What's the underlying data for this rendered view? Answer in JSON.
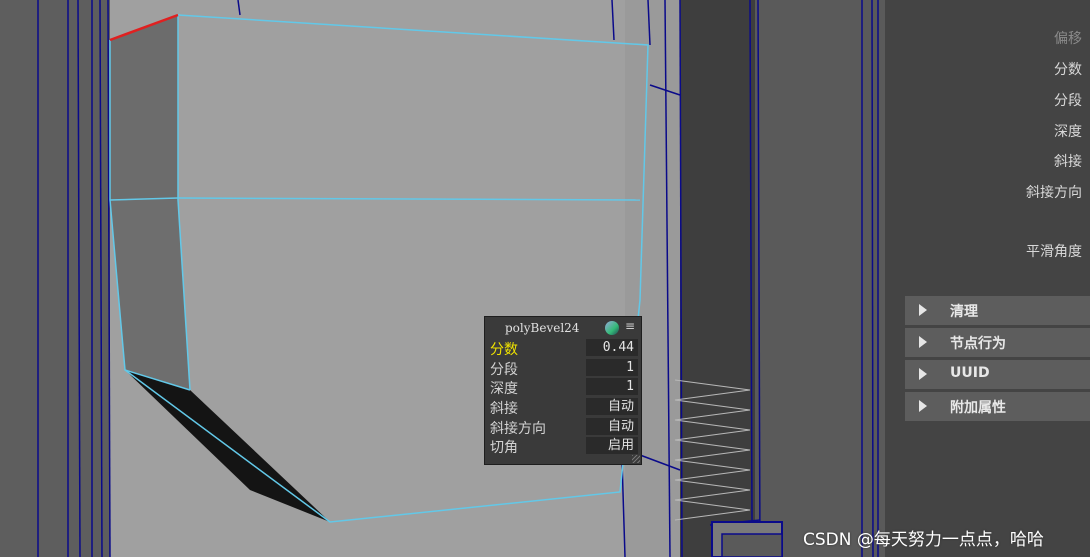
{
  "attribute_editor": {
    "labels": [
      "偏移",
      "分数",
      "分段",
      "深度",
      "斜接",
      "斜接方向",
      "平滑角度"
    ],
    "sections": [
      "清理",
      "节点行为",
      "UUID",
      "附加属性"
    ]
  },
  "hud": {
    "title": "polyBevel24",
    "menu_icon": "≡",
    "rows": [
      {
        "label": "分数",
        "value": "0.44"
      },
      {
        "label": "分段",
        "value": "1"
      },
      {
        "label": "深度",
        "value": "1"
      },
      {
        "label": "斜接",
        "value": "自动"
      },
      {
        "label": "斜接方向",
        "value": "自动"
      },
      {
        "label": "切角",
        "value": "启用"
      }
    ]
  },
  "watermark": "CSDN @每天努力一点点，哈哈",
  "colors": {
    "wireframe_selected": "#62c8e8",
    "wireframe": "#0a0a8a",
    "edge_highlight": "#e02020",
    "active_label": "#f0e300"
  }
}
